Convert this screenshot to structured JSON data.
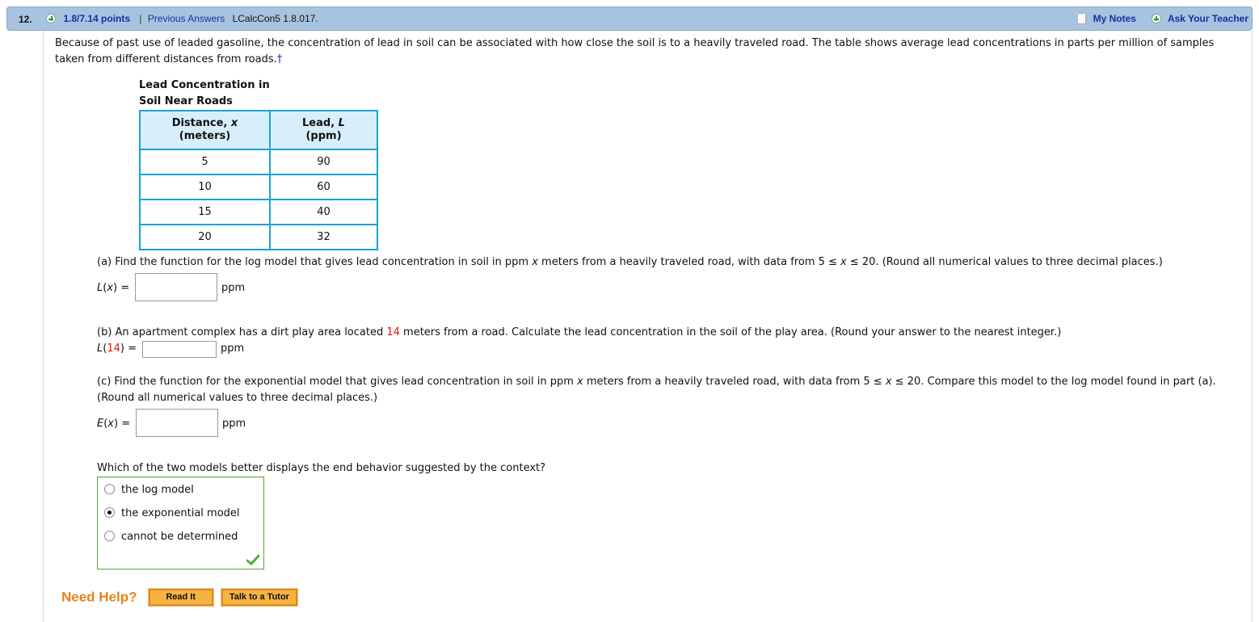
{
  "header": {
    "question_number": "12.",
    "points": "1.8/7.14 points",
    "separator": "|",
    "previous_answers": "Previous Answers",
    "problem_code": "LCalcCon5 1.8.017.",
    "my_notes": "My Notes",
    "ask_teacher": "Ask Your Teacher"
  },
  "intro": {
    "text": "Because of past use of leaded gasoline, the concentration of lead in soil can be associated with how close the soil is to a heavily traveled road. The table shows average lead concentrations in parts per million of samples taken from different distances from roads.",
    "dagger": "†"
  },
  "table": {
    "title_line1": "Lead Concentration in",
    "title_line2": "Soil Near Roads",
    "headers": [
      {
        "main": "Distance, ",
        "var": "x",
        "unit": "(meters)"
      },
      {
        "main": "Lead, ",
        "var": "L",
        "unit": "(ppm)"
      }
    ],
    "rows": [
      [
        "5",
        "90"
      ],
      [
        "10",
        "60"
      ],
      [
        "15",
        "40"
      ],
      [
        "20",
        "32"
      ]
    ]
  },
  "part_a": {
    "prompt_1": "(a) Find the function for the log model that gives lead concentration in soil in ppm ",
    "prompt_var": "x",
    "prompt_2": " meters from a heavily traveled road, with data from  5 ≤ ",
    "prompt_var2": "x",
    "prompt_3": " ≤ 20.  (Round all numerical values to three decimal places.)",
    "label_fn": "L",
    "label_arg": "(",
    "label_var": "x",
    "label_end": ") =",
    "value": "",
    "unit": "ppm"
  },
  "part_b": {
    "prompt_1": "(b) An apartment complex has a dirt play area located ",
    "highlight": "14",
    "prompt_2": " meters from a road. Calculate the lead concentration in the soil of the play area. (Round your answer to the nearest integer.)",
    "label_fn": "L",
    "label_open": "(",
    "label_arg": "14",
    "label_end": ") =",
    "value": "",
    "unit": "ppm"
  },
  "part_c": {
    "prompt_1": "(c) Find the function for the exponential model that gives lead concentration in soil in ppm ",
    "prompt_var": "x",
    "prompt_2": " meters from a heavily traveled road, with data from  5 ≤ ",
    "prompt_var2": "x",
    "prompt_3": " ≤ 20.  Compare this model to the log model found in part (a).",
    "prompt_line2": "(Round all numerical values to three decimal places.)",
    "label_fn": "E",
    "label_open": "(",
    "label_var": "x",
    "label_end": ") =",
    "value": "",
    "unit": "ppm"
  },
  "multiple_choice": {
    "question": "Which of the two models better displays the end behavior suggested by the context?",
    "options": [
      {
        "label": "the log model",
        "selected": false
      },
      {
        "label": "the exponential model",
        "selected": true
      },
      {
        "label": "cannot be determined",
        "selected": false
      }
    ],
    "status": "correct"
  },
  "help": {
    "label": "Need Help?",
    "read_it": "Read It",
    "talk_to_tutor": "Talk to a Tutor"
  },
  "colors": {
    "header_bg": "#a7c3e0",
    "link": "#1a2ea0",
    "table_border": "#1aa2dc",
    "table_header_bg": "#d7effa",
    "highlight_red": "#e01010",
    "correct_border": "#5aa03a",
    "help_orange": "#e8821a"
  }
}
